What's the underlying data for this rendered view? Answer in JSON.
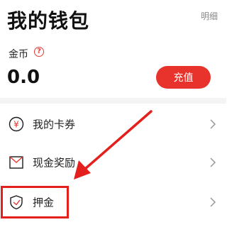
{
  "header": {
    "title": "我的钱包",
    "detail_link": "明细"
  },
  "coins": {
    "label": "金币",
    "help_icon": "?",
    "balance": "0.0",
    "recharge_label": "充值"
  },
  "menu": {
    "items": [
      {
        "label": "我的卡券",
        "icon": "coupon-icon",
        "icon_glyph": "¥"
      },
      {
        "label": "现金奖励",
        "icon": "envelope-icon"
      },
      {
        "label": "押金",
        "icon": "shield-icon"
      }
    ]
  },
  "colors": {
    "accent": "#e8322c",
    "annotation": "#e3201c"
  }
}
